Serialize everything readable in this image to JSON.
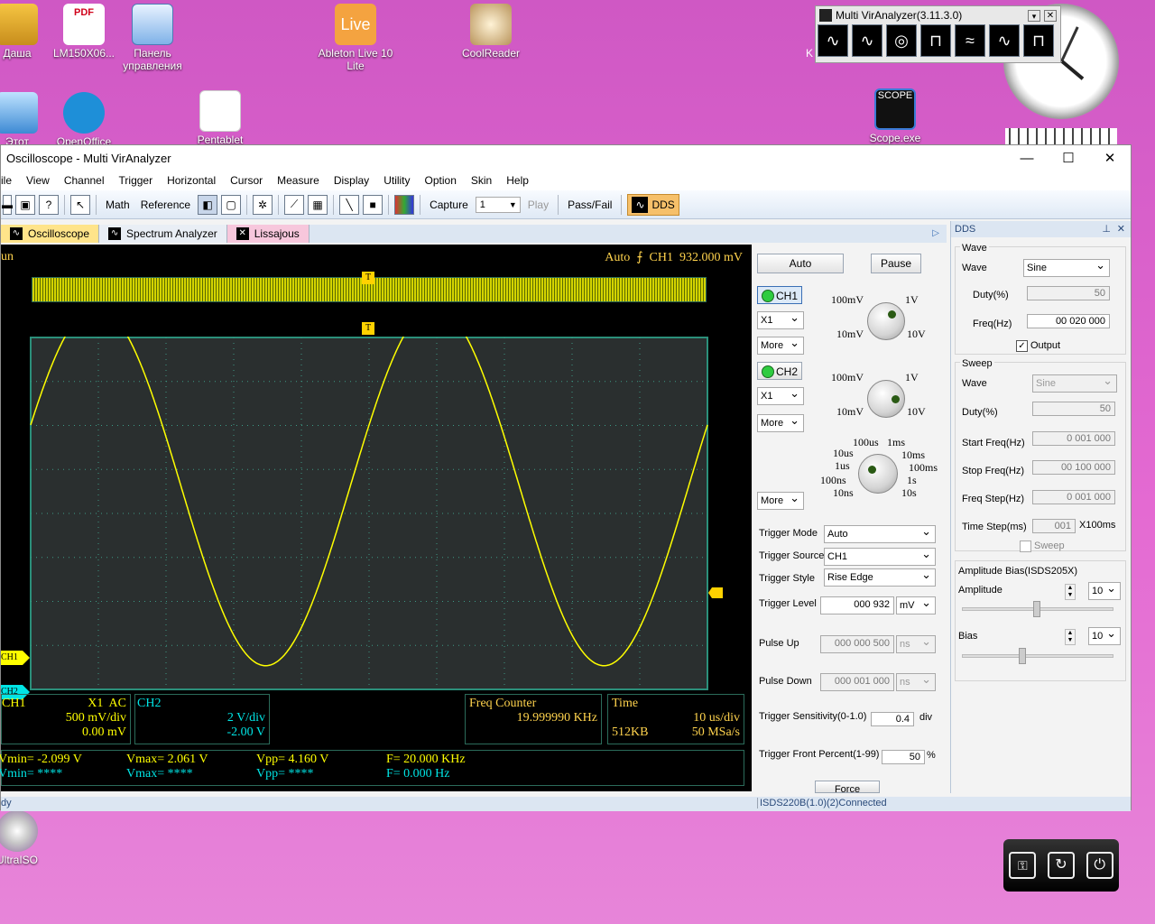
{
  "desktop": {
    "icons": [
      {
        "label": "Даша"
      },
      {
        "label": "LM150X06..."
      },
      {
        "label": "Панель управления"
      },
      {
        "label": "Ableton Live 10 Lite"
      },
      {
        "label": "CoolReader"
      },
      {
        "label": "Этот"
      },
      {
        "label": "OpenOffice"
      },
      {
        "label": "Pentablet"
      },
      {
        "label": "Scope.exe"
      },
      {
        "label": "UltraISO"
      }
    ],
    "pdf_badge": "PDF",
    "live_badge": "Live",
    "scope_badge": "SCOPE",
    "k_text": "K",
    "colors": {
      "background": "#e06acd",
      "trace": "#ffff00",
      "grid": "#2b6b5a"
    }
  },
  "gadget": {
    "title": "Multi VirAnalyzer(3.11.3.0)"
  },
  "window": {
    "title": "Oscilloscope - Multi VirAnalyzer",
    "menu": [
      "ile",
      "View",
      "Channel",
      "Trigger",
      "Horizontal",
      "Cursor",
      "Measure",
      "Display",
      "Utility",
      "Option",
      "Skin",
      "Help"
    ],
    "toolbar": {
      "math": "Math",
      "reference": "Reference",
      "capture": "Capture",
      "capture_value": "1",
      "play": "Play",
      "passfail": "Pass/Fail",
      "dds": "DDS"
    },
    "tabs": [
      "Oscilloscope",
      "Spectrum Analyzer",
      "Lissajous"
    ],
    "status_left": "dy",
    "status_conn": "ISDS220B(1.0)(2)Connected"
  },
  "scope": {
    "run": "un",
    "trigger_info": "Auto  ⨍  CH1  932.000 mV",
    "ch1": "CH1",
    "ch2": "CH2",
    "ch1_box": {
      "name": "CH1",
      "coupling": "X1  AC",
      "vdiv": "500 mV/div",
      "offset": "0.00 mV"
    },
    "ch2_box": {
      "name": "CH2",
      "vdiv": "2 V/div",
      "offset": "-2.00 V"
    },
    "freq_box": {
      "name": "Freq Counter",
      "value": "19.999990 KHz"
    },
    "time_box": {
      "name": "Time",
      "tdiv": "10 us/div",
      "depth": "512KB",
      "rate": "50 MSa/s"
    },
    "meas1": [
      "Vmin= -2.099 V",
      "Vmax= 2.061 V",
      "Vpp= 4.160 V",
      "F= 20.000 KHz"
    ],
    "meas2": [
      "Vmin= ****",
      "Vmax= ****",
      "Vpp= ****",
      "F= 0.000 Hz"
    ],
    "waveform": {
      "cycles": 2,
      "amplitude_v": 2.08,
      "frequency_khz": 20,
      "time_div_us": 10
    }
  },
  "panel": {
    "auto": "Auto",
    "pause": "Pause",
    "ch1": "CH1",
    "ch2": "CH2",
    "probe": "X1",
    "more": "More",
    "vk": {
      "a": "100mV",
      "b": "1V",
      "c": "10mV",
      "d": "10V"
    },
    "tk": {
      "a": "100us",
      "b": "1ms",
      "c": "10us",
      "d": "10ms",
      "e": "1us",
      "f": "100ms",
      "g": "100ns",
      "h": "1s",
      "i": "10ns",
      "j": "10s"
    },
    "trigger_mode_label": "Trigger Mode",
    "trigger_mode": "Auto",
    "trigger_source_label": "Trigger Source",
    "trigger_source": "CH1",
    "trigger_style_label": "Trigger Style",
    "trigger_style": "Rise Edge",
    "trigger_level_label": "Trigger Level",
    "trigger_level": "000 932",
    "trigger_unit": "mV",
    "pulse_up_label": "Pulse Up",
    "pulse_up": "000 000 500",
    "pulse_down_label": "Pulse Down",
    "pulse_down": "000 001 000",
    "ns": "ns",
    "sens_label": "Trigger Sensitivity(0-1.0)",
    "sens": "0.4",
    "div": "div",
    "front_label": "Trigger Front Percent(1-99)",
    "front": "50",
    "pct": "%",
    "force": "Force"
  },
  "dds": {
    "title": "DDS",
    "wave_group": "Wave",
    "wave_label": "Wave",
    "wave": "Sine",
    "duty_label": "Duty(%)",
    "duty": "50",
    "freq_label": "Freq(Hz)",
    "freq": "00 020 000",
    "output": "Output",
    "sweep_group": "Sweep",
    "s_wave": "Sine",
    "s_duty": "50",
    "start_label": "Start Freq(Hz)",
    "start": "0 001 000",
    "stop_label": "Stop Freq(Hz)",
    "stop": "00 100 000",
    "step_label": "Freq Step(Hz)",
    "step": "0 001 000",
    "tstep_label": "Time Step(ms)",
    "tstep": "001",
    "tstep_unit": "X100ms",
    "sweep": "Sweep",
    "amp_group": "Amplitude Bias(ISDS205X)",
    "amp_label": "Amplitude",
    "amp": "10",
    "bias_label": "Bias",
    "bias": "10"
  }
}
